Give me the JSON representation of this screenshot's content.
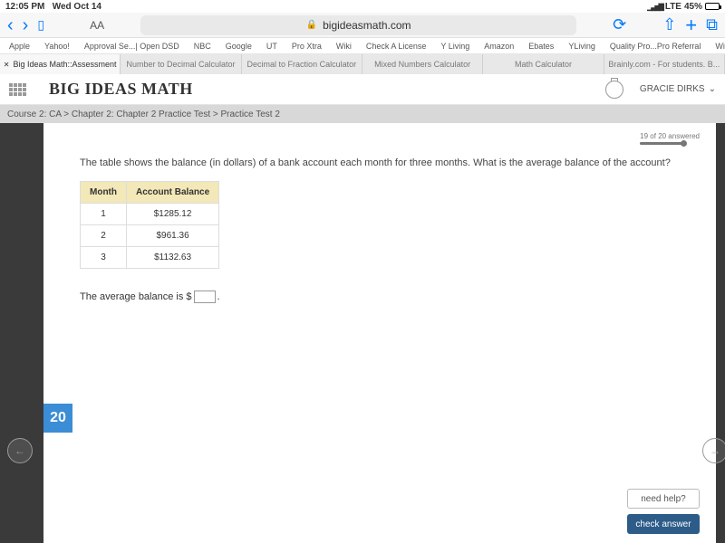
{
  "status": {
    "time": "12:05 PM",
    "date": "Wed Oct 14",
    "network": "LTE",
    "battery": "45%"
  },
  "browser": {
    "url": "bigideasmath.com",
    "aa": "AA",
    "bookmarks": [
      "Apple",
      "Yahoo!",
      "Approval Se...| Open DSD",
      "NBC",
      "Google",
      "UT",
      "Pro Xtra",
      "Wiki",
      "Check A License",
      "Y Living",
      "Amazon",
      "Ebates",
      "YLiving",
      "Quality Pro...Pro Referral",
      "Windows Server"
    ],
    "tabs": [
      {
        "label": "Big Ideas Math::Assessment",
        "active": true
      },
      {
        "label": "Number to Decimal Calculator",
        "active": false
      },
      {
        "label": "Decimal to Fraction Calculator",
        "active": false
      },
      {
        "label": "Mixed Numbers Calculator",
        "active": false
      },
      {
        "label": "Math Calculator",
        "active": false
      },
      {
        "label": "Brainly.com - For students. B...",
        "active": false
      }
    ]
  },
  "app": {
    "logo": "BIG IDEAS MATH",
    "user": "GRACIE DIRKS",
    "breadcrumb": "Course 2: CA > Chapter 2: Chapter 2 Practice Test > Practice Test 2",
    "progress_text": "19 of 20 answered"
  },
  "question": {
    "number": "20",
    "prompt": "The table shows the balance (in dollars) of a bank account each month for three months. What is the average balance of the account?",
    "table": {
      "headers": [
        "Month",
        "Account Balance"
      ],
      "rows": [
        [
          "1",
          "$1285.12"
        ],
        [
          "2",
          "$961.36"
        ],
        [
          "3",
          "$1132.63"
        ]
      ]
    },
    "answer_prefix": "The average balance is $",
    "answer_value": "",
    "answer_suffix": "."
  },
  "buttons": {
    "help": "need help?",
    "check": "check answer"
  }
}
